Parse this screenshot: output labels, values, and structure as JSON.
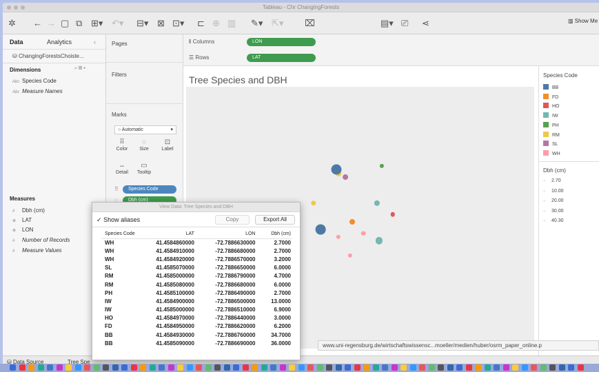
{
  "window": {
    "title": "Tableau - Chr ChangingForests"
  },
  "toolbar": {
    "show_me": "Show Me"
  },
  "data_pane": {
    "tabs": {
      "data": "Data",
      "analytics": "Analytics"
    },
    "datasource": "ChangingForestsChoiste...",
    "dimensions_title": "Dimensions",
    "dimensions": [
      {
        "icon": "Abc",
        "label": "Species Code"
      },
      {
        "icon": "Abc",
        "label": "Measure Names"
      }
    ],
    "measures_title": "Measures",
    "measures": [
      {
        "icon": "#",
        "label": "Dbh (cm)"
      },
      {
        "icon": "⊕",
        "label": "LAT"
      },
      {
        "icon": "⊕",
        "label": "LON"
      },
      {
        "icon": "#",
        "label": "Number of Records"
      },
      {
        "icon": "#",
        "label": "Measure Values"
      }
    ]
  },
  "cards": {
    "pages": "Pages",
    "filters": "Filters",
    "marks": "Marks",
    "mark_type": "Automatic",
    "mark_buttons": {
      "color": "Color",
      "size": "Size",
      "label": "Label",
      "detail": "Detail",
      "tooltip": "Tooltip"
    },
    "pill_species": "Species Code",
    "pill_dbh": "Dbh (cm)"
  },
  "shelves": {
    "columns_label": "Columns",
    "columns_pill": "LON",
    "rows_label": "Rows",
    "rows_pill": "LAT"
  },
  "viz": {
    "title": "Tree Species and DBH"
  },
  "legend": {
    "color_title": "Species Code",
    "color_items": [
      {
        "label": "BB",
        "color": "#4e79a7"
      },
      {
        "label": "FD",
        "color": "#f28e2b"
      },
      {
        "label": "HO",
        "color": "#e15759"
      },
      {
        "label": "IW",
        "color": "#76b7b2"
      },
      {
        "label": "PH",
        "color": "#59a14f"
      },
      {
        "label": "RM",
        "color": "#edc948"
      },
      {
        "label": "SL",
        "color": "#b07aa1"
      },
      {
        "label": "WH",
        "color": "#ff9da7"
      }
    ],
    "size_title": "Dbh (cm)",
    "size_items": [
      "2.70",
      "10.00",
      "20.00",
      "30.00",
      "40.30"
    ]
  },
  "dialog": {
    "title": "View Data: Tree Species and DBH",
    "show_aliases": "Show aliases",
    "copy": "Copy",
    "export_all": "Export All",
    "headers": [
      "Species Code",
      "LAT",
      "LON",
      "Dbh (cm)"
    ],
    "rows": [
      [
        "WH",
        "41.4584860000",
        "-72.7886630000",
        "2.7000"
      ],
      [
        "WH",
        "41.4584910000",
        "-72.7886680000",
        "2.7000"
      ],
      [
        "WH",
        "41.4584920000",
        "-72.7886570000",
        "3.2000"
      ],
      [
        "SL",
        "41.4585070000",
        "-72.7886650000",
        "6.0000"
      ],
      [
        "RM",
        "41.4585000000",
        "-72.7886790000",
        "4.7000"
      ],
      [
        "RM",
        "41.4585080000",
        "-72.7886680000",
        "6.0000"
      ],
      [
        "PH",
        "41.4585100000",
        "-72.7886490000",
        "2.7000"
      ],
      [
        "IW",
        "41.4584900000",
        "-72.7886500000",
        "13.0000"
      ],
      [
        "IW",
        "41.4585000000",
        "-72.7886510000",
        "6.9000"
      ],
      [
        "HO",
        "41.4584970000",
        "-72.7886440000",
        "3.0000"
      ],
      [
        "FD",
        "41.4584950000",
        "-72.7886620000",
        "6.2000"
      ],
      [
        "BB",
        "41.4584930000",
        "-72.7886760000",
        "34.7000"
      ],
      [
        "BB",
        "41.4585090000",
        "-72.7886690000",
        "36.0000"
      ]
    ]
  },
  "status": {
    "data_source": "Data Source",
    "sheet": "Tree Spe"
  },
  "url_tooltip": "www.uni-regensburg.de/wirtschaftswissensc...moeller/medien/huber/osrm_paper_online.p"
}
